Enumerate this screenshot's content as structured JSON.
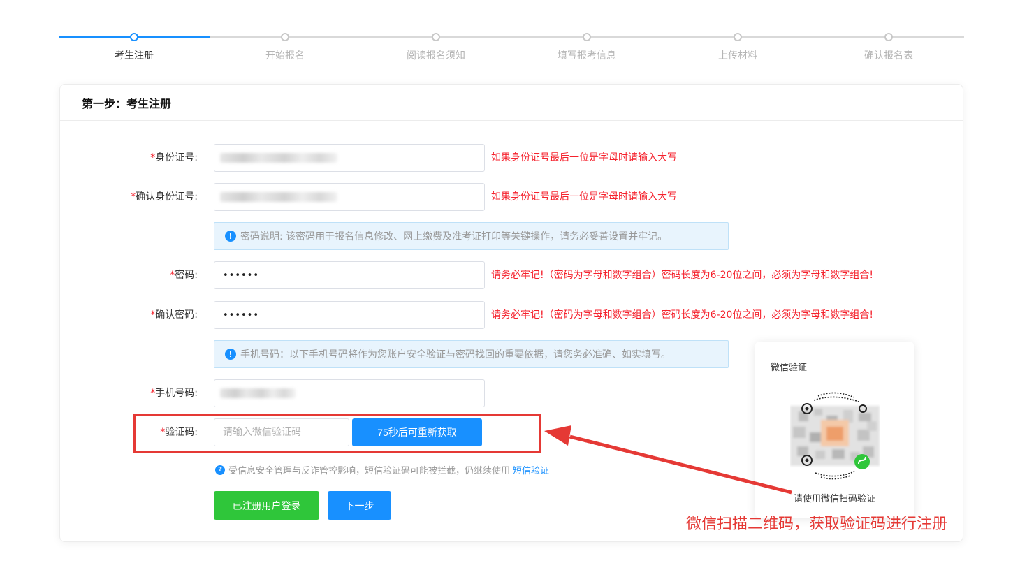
{
  "steps": [
    {
      "label": "考生注册"
    },
    {
      "label": "开始报名"
    },
    {
      "label": "阅读报名须知"
    },
    {
      "label": "填写报考信息"
    },
    {
      "label": "上传材料"
    },
    {
      "label": "确认报名表"
    }
  ],
  "card": {
    "title": "第一步：考生注册"
  },
  "form": {
    "required_mark": "*",
    "id_label": "身份证号:",
    "id_hint": "如果身份证号最后一位是字母时请输入大写",
    "confirm_id_label": "确认身份证号:",
    "confirm_id_hint": "如果身份证号最后一位是字母时请输入大写",
    "password_note": "密码说明: 该密码用于报名信息修改、网上缴费及准考证打印等关键操作，请务必妥善设置并牢记。",
    "password_label": "密码:",
    "password_value": "••••••",
    "password_hint": "请务必牢记!（密码为字母和数字组合）密码长度为6-20位之间，必须为字母和数字组合!",
    "confirm_password_label": "确认密码:",
    "confirm_password_value": "••••••",
    "confirm_password_hint": "请务必牢记!（密码为字母和数字组合）密码长度为6-20位之间，必须为字母和数字组合!",
    "phone_note": "手机号码：以下手机号码将作为您账户安全验证与密码找回的重要依据，请您务必准确、如实填写。",
    "phone_label": "手机号码:",
    "code_label": "验证码:",
    "code_placeholder": "请输入微信验证码",
    "resend_button": "75秒后可重新获取",
    "sms_tip": "受信息安全管理与反诈管控影响，短信验证码可能被拦截，仍继续使用",
    "sms_link": "短信验证",
    "login_button": "已注册用户登录",
    "next_button": "下一步"
  },
  "wechat": {
    "title": "微信验证",
    "caption": "请使用微信扫码验证"
  },
  "annotation": {
    "text": "微信扫描二维码，获取验证码进行注册"
  },
  "colors": {
    "primary": "#1890ff",
    "success": "#2fc63a",
    "danger": "#f5222d",
    "annotation": "#e53935"
  }
}
